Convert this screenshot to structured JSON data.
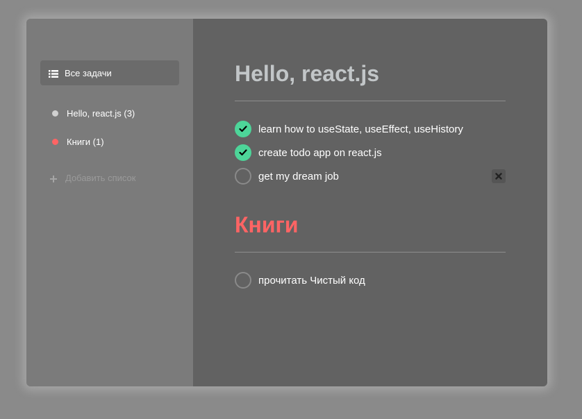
{
  "sidebar": {
    "all_tasks_label": "Все задачи",
    "lists": [
      {
        "label": "Hello, react.js (3)",
        "color": "#d0d0d0"
      },
      {
        "label": "Книги (1)",
        "color": "#ff6464"
      }
    ],
    "add_list_label": "Добавить список"
  },
  "main": {
    "sections": [
      {
        "title": "Hello, react.js",
        "title_color": "#c2c6c8",
        "tasks": [
          {
            "text": "learn how to useState, useEffect, useHistory",
            "completed": true
          },
          {
            "text": "create todo app on react.js",
            "completed": true
          },
          {
            "text": "get my dream job",
            "completed": false
          }
        ]
      },
      {
        "title": "Книги",
        "title_color": "#ff6464",
        "tasks": [
          {
            "text": "прочитать Чистый код",
            "completed": false
          }
        ]
      }
    ]
  },
  "colors": {
    "accent_green": "#4dd599",
    "sidebar_bg": "#7b7b7b",
    "main_bg": "#626262"
  }
}
